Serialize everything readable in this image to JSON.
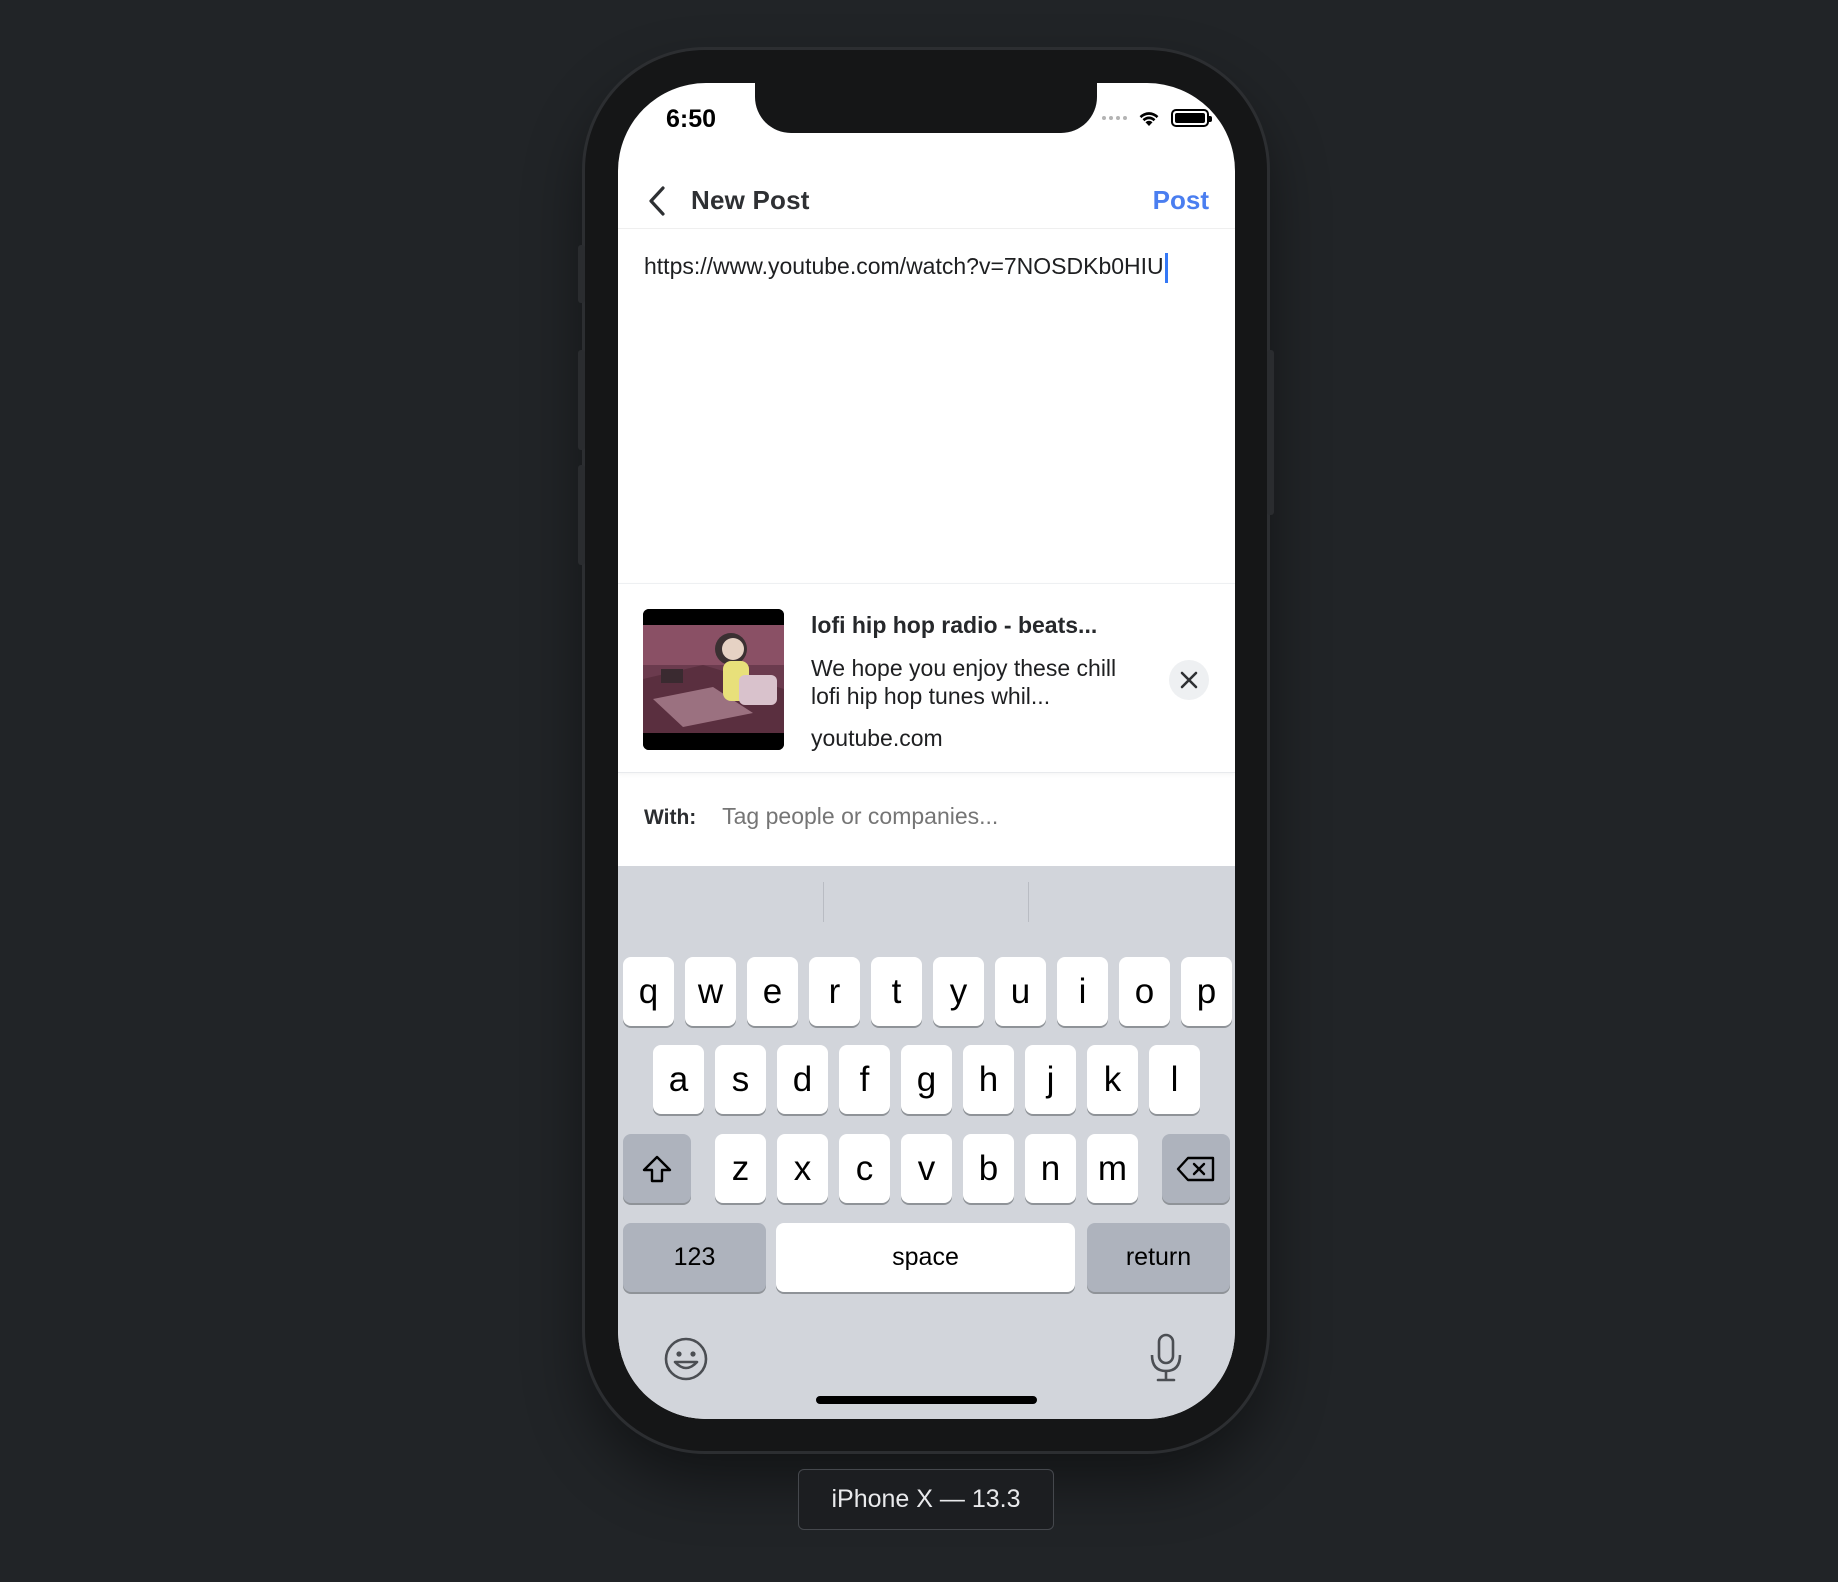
{
  "status_bar": {
    "time": "6:50"
  },
  "nav": {
    "back_icon": "chevron-left-icon",
    "title": "New Post",
    "post_label": "Post",
    "accent_color": "#4a7ef0"
  },
  "composer": {
    "text": "https://www.youtube.com/watch?v=7NOSDKb0HIU"
  },
  "link_preview": {
    "title": "lofi hip hop radio - beats...",
    "description": "We hope you enjoy these chill lofi hip hop tunes whil...",
    "domain": "youtube.com",
    "close_icon": "close-icon"
  },
  "tag_row": {
    "label": "With:",
    "placeholder": "Tag people or companies..."
  },
  "keyboard": {
    "row1": [
      "q",
      "w",
      "e",
      "r",
      "t",
      "y",
      "u",
      "i",
      "o",
      "p"
    ],
    "row2": [
      "a",
      "s",
      "d",
      "f",
      "g",
      "h",
      "j",
      "k",
      "l"
    ],
    "row3": [
      "z",
      "x",
      "c",
      "v",
      "b",
      "n",
      "m"
    ],
    "numbers_label": "123",
    "space_label": "space",
    "return_label": "return"
  },
  "device_label": "iPhone X — 13.3"
}
